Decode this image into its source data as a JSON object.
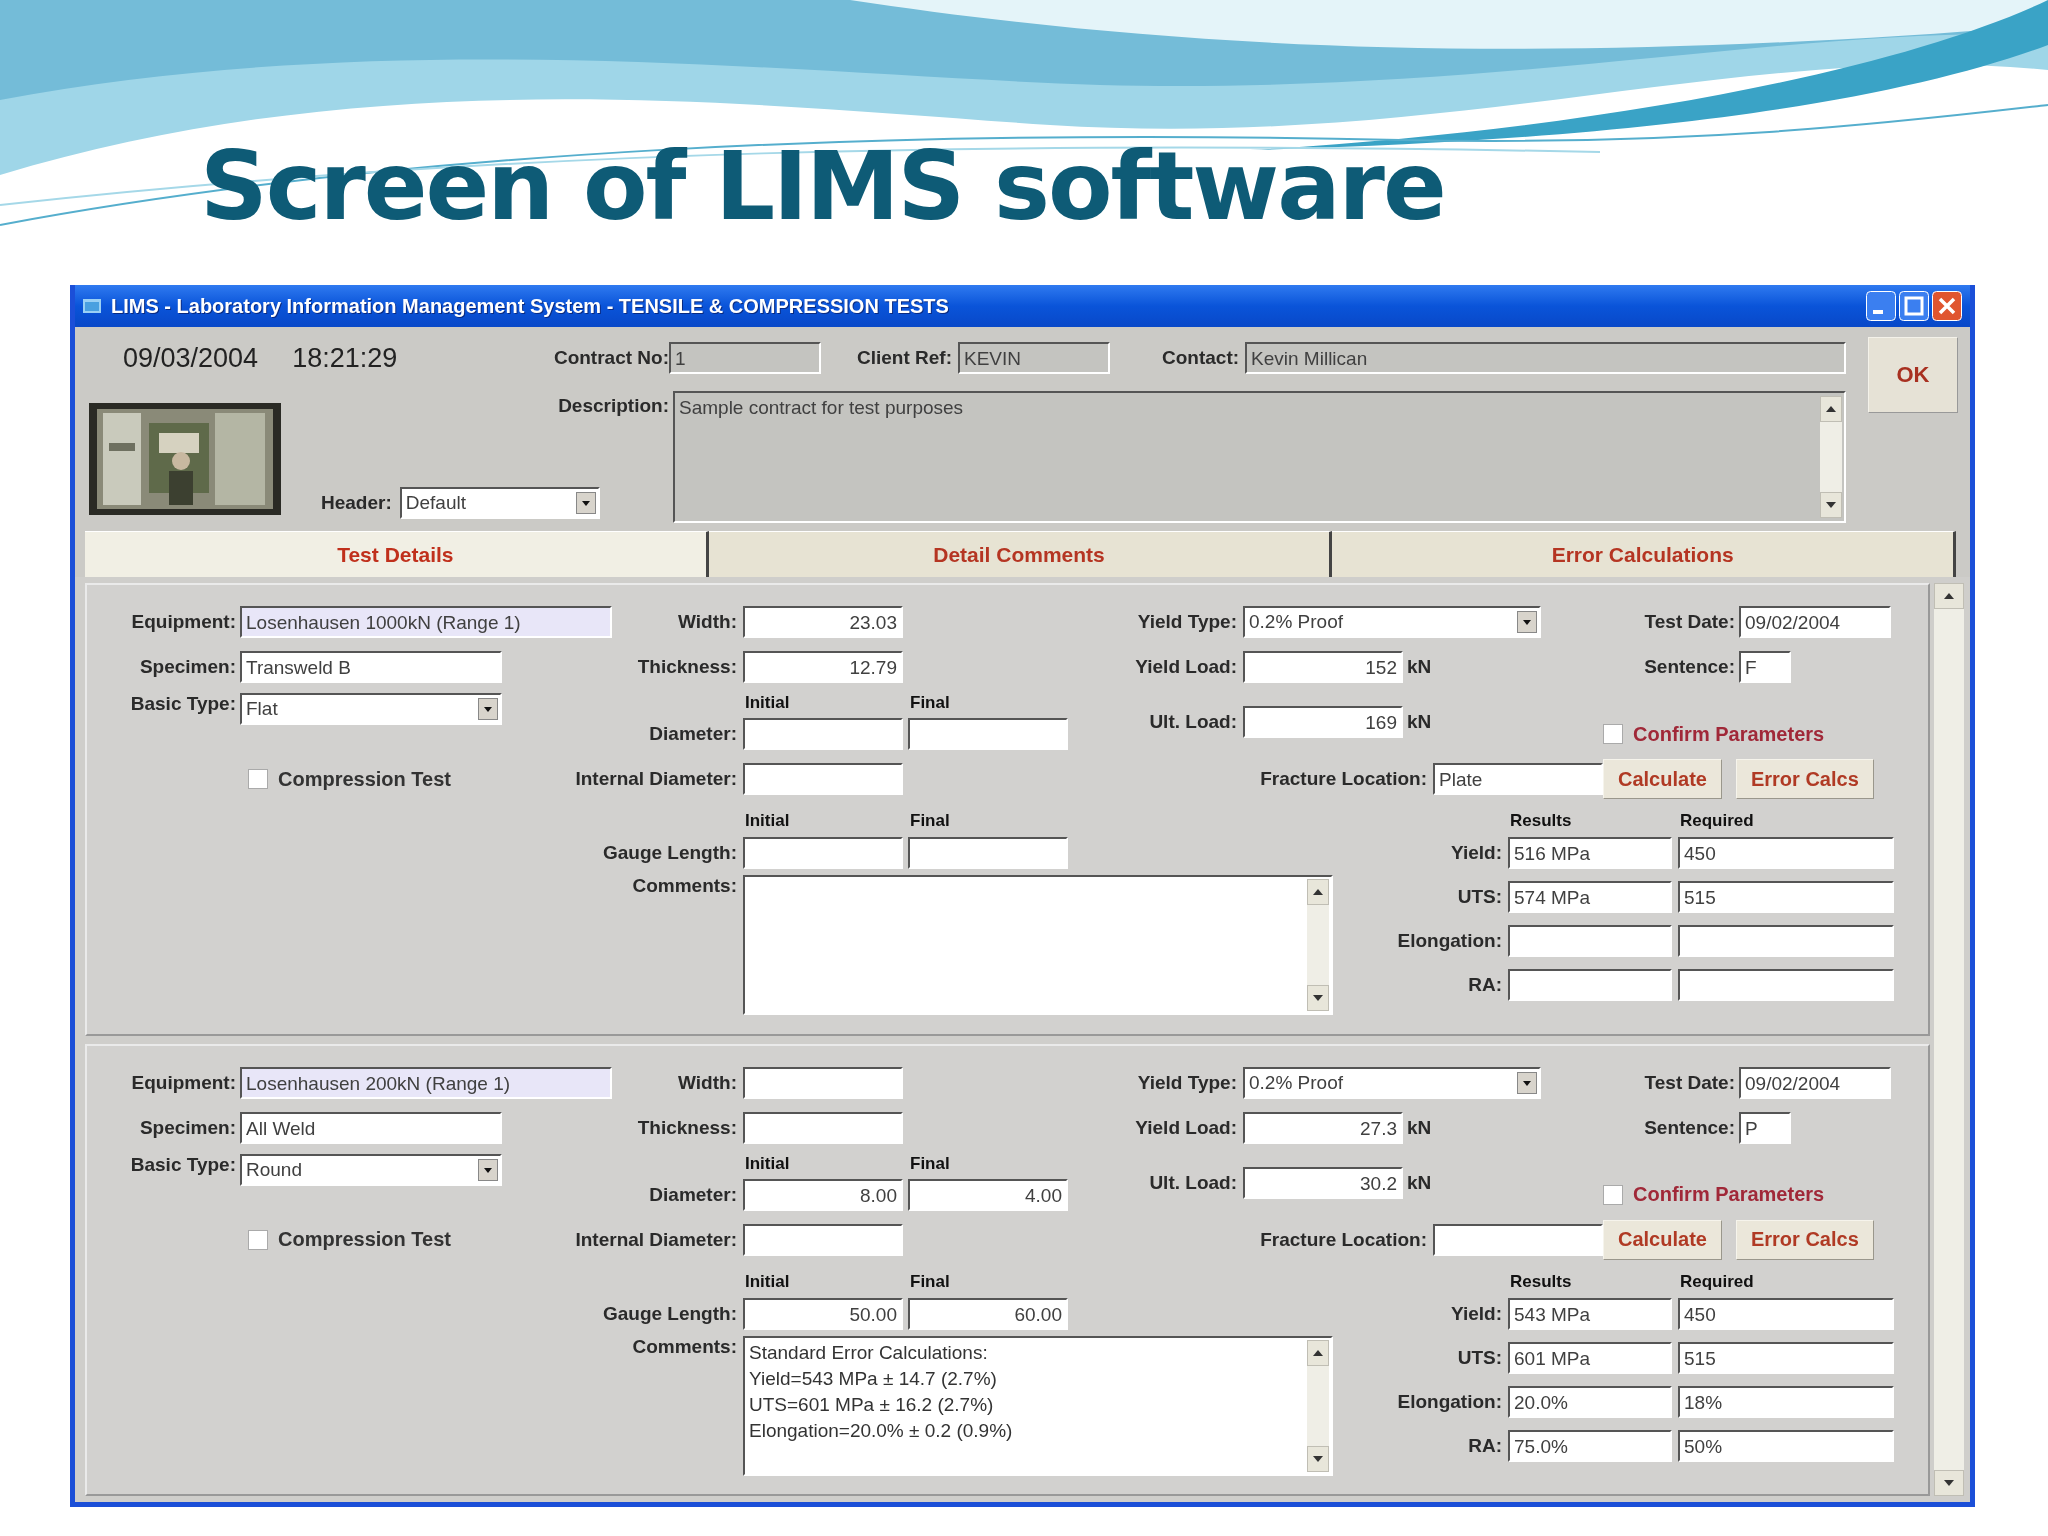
{
  "slide_title": "Screen of LIMS software",
  "window": {
    "title": "LIMS - Laboratory Information Management System - TENSILE & COMPRESSION TESTS"
  },
  "header": {
    "date": "09/03/2004",
    "time": "18:21:29",
    "contract_no": {
      "label": "Contract No:",
      "value": "1"
    },
    "client_ref": {
      "label": "Client Ref:",
      "value": "KEVIN"
    },
    "contact": {
      "label": "Contact:",
      "value": "Kevin Millican"
    },
    "description": {
      "label": "Description:",
      "value": "Sample contract for test purposes"
    },
    "header_select": {
      "label": "Header:",
      "value": "Default"
    },
    "ok_button": "OK"
  },
  "tabs": [
    {
      "label": "Test Details",
      "selected": true
    },
    {
      "label": "Detail Comments",
      "selected": false
    },
    {
      "label": "Error Calculations",
      "selected": false
    }
  ],
  "records": [
    {
      "equipment": {
        "label": "Equipment:",
        "value": "Losenhausen 1000kN (Range 1)"
      },
      "specimen": {
        "label": "Specimen:",
        "value": "Transweld B"
      },
      "basic_type": {
        "label": "Basic Type:",
        "value": "Flat"
      },
      "compression_test": {
        "label": "Compression Test",
        "checked": false
      },
      "width": {
        "label": "Width:",
        "value": "23.03"
      },
      "thickness": {
        "label": "Thickness:",
        "value": "12.79"
      },
      "diameter": {
        "label": "Diameter:",
        "initial_heading": "Initial",
        "final_heading": "Final"
      },
      "internal_diameter": {
        "label": "Internal Diameter:"
      },
      "gauge_length": {
        "label": "Gauge Length:",
        "initial_heading": "Initial",
        "final_heading": "Final"
      },
      "comments": {
        "label": "Comments:"
      },
      "yield_type": {
        "label": "Yield Type:",
        "value": "0.2% Proof"
      },
      "yield_load": {
        "label": "Yield Load:",
        "value": "152",
        "unit": "kN"
      },
      "ult_load": {
        "label": "Ult. Load:",
        "value": "169",
        "unit": "kN"
      },
      "fracture_location": {
        "label": "Fracture Location:",
        "value": "Plate"
      },
      "test_date": {
        "label": "Test Date:",
        "value": "09/02/2004"
      },
      "sentence": {
        "label": "Sentence:",
        "value": "F"
      },
      "confirm_parameters": {
        "label": "Confirm Parameters",
        "checked": false
      },
      "buttons": [
        "Calculate",
        "Error Calcs"
      ],
      "results_heading": "Results",
      "required_heading": "Required",
      "results": [
        {
          "label": "Yield:",
          "result": "516 MPa",
          "required": "450"
        },
        {
          "label": "UTS:",
          "result": "574 MPa",
          "required": "515"
        },
        {
          "label": "Elongation:"
        },
        {
          "label": "RA:"
        }
      ]
    },
    {
      "equipment": {
        "label": "Equipment:",
        "value": "Losenhausen 200kN (Range 1)"
      },
      "specimen": {
        "label": "Specimen:",
        "value": "All Weld"
      },
      "basic_type": {
        "label": "Basic Type:",
        "value": "Round"
      },
      "compression_test": {
        "label": "Compression Test",
        "checked": false
      },
      "width": {
        "label": "Width:"
      },
      "thickness": {
        "label": "Thickness:"
      },
      "diameter": {
        "label": "Diameter:",
        "initial_heading": "Initial",
        "final_heading": "Final",
        "initial": "8.00",
        "final": "4.00"
      },
      "internal_diameter": {
        "label": "Internal Diameter:"
      },
      "gauge_length": {
        "label": "Gauge Length:",
        "initial_heading": "Initial",
        "final_heading": "Final",
        "initial": "50.00",
        "final": "60.00"
      },
      "comments": {
        "label": "Comments:",
        "lines": [
          "Standard Error Calculations:",
          "Yield=543 MPa ± 14.7 (2.7%)",
          "UTS=601 MPa ± 16.2 (2.7%)",
          "Elongation=20.0% ± 0.2 (0.9%)"
        ]
      },
      "yield_type": {
        "label": "Yield Type:",
        "value": "0.2% Proof"
      },
      "yield_load": {
        "label": "Yield Load:",
        "value": "27.3",
        "unit": "kN"
      },
      "ult_load": {
        "label": "Ult. Load:",
        "value": "30.2",
        "unit": "kN"
      },
      "fracture_location": {
        "label": "Fracture Location:"
      },
      "test_date": {
        "label": "Test Date:",
        "value": "09/02/2004"
      },
      "sentence": {
        "label": "Sentence:",
        "value": "P"
      },
      "confirm_parameters": {
        "label": "Confirm Parameters",
        "checked": false
      },
      "buttons": [
        "Calculate",
        "Error Calcs"
      ],
      "results_heading": "Results",
      "required_heading": "Required",
      "results": [
        {
          "label": "Yield:",
          "result": "543 MPa",
          "required": "450"
        },
        {
          "label": "UTS:",
          "result": "601 MPa",
          "required": "515"
        },
        {
          "label": "Elongation:",
          "result": "20.0%",
          "required": "18%"
        },
        {
          "label": "RA:",
          "result": "75.0%",
          "required": "50%"
        }
      ]
    }
  ]
}
